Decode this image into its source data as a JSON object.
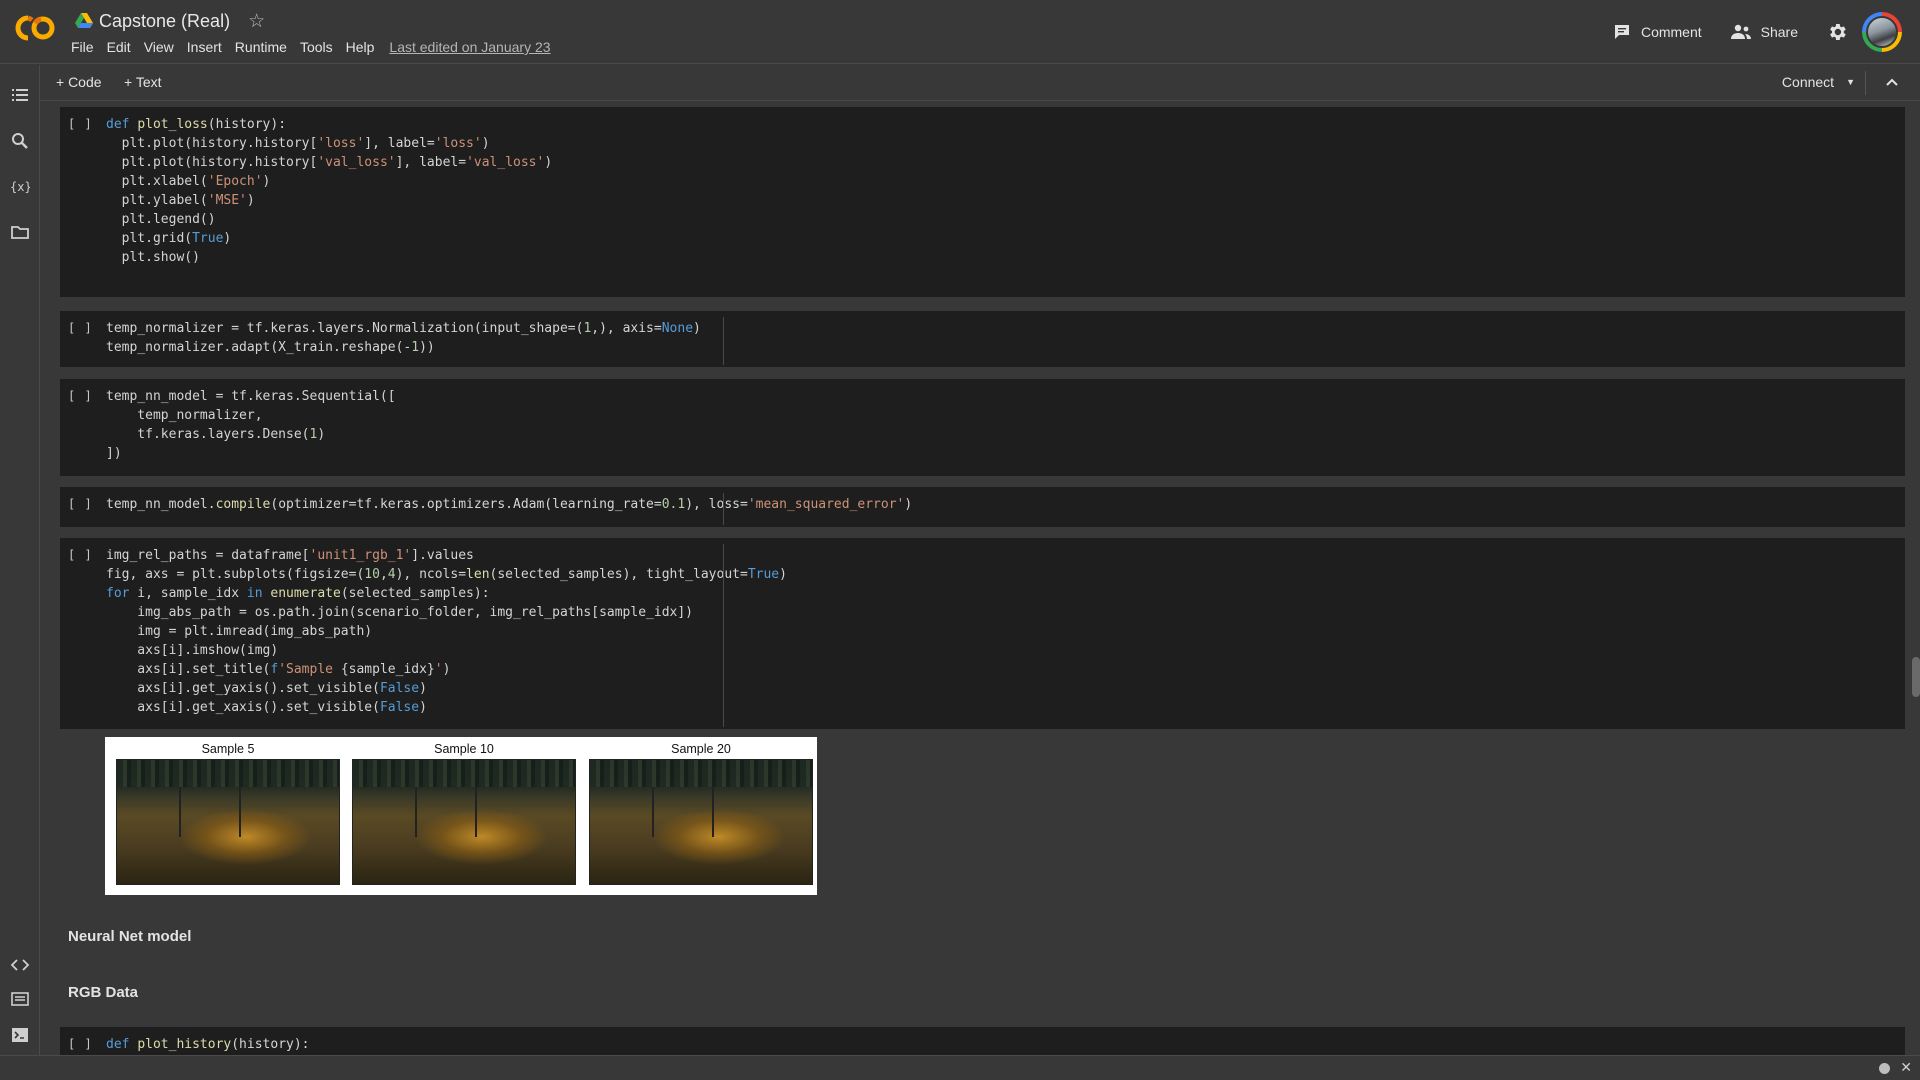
{
  "app": {
    "logo": "colab-logo",
    "title": "Capstone (Real)"
  },
  "menu": [
    "File",
    "Edit",
    "View",
    "Insert",
    "Runtime",
    "Tools",
    "Help"
  ],
  "last_edited": "Last edited on January 23",
  "header_actions": {
    "comment": "Comment",
    "share": "Share"
  },
  "toolbar": {
    "add_code": "+ Code",
    "add_text": "+ Text",
    "connect": "Connect"
  },
  "cells": [
    {
      "run": "[ ]"
    },
    {
      "run": "[ ]"
    },
    {
      "run": "[ ]"
    },
    {
      "run": "[ ]"
    },
    {
      "run": "[ ]"
    },
    {
      "run": "[ ]"
    }
  ],
  "figure": {
    "titles": [
      "Sample 5",
      "Sample 10",
      "Sample 20"
    ]
  },
  "headings": {
    "neural_net": "Neural Net model",
    "rgb_data": "RGB Data"
  },
  "icons": [
    "toc-icon",
    "search-icon",
    "variables-icon",
    "files-icon",
    "code-snippets-icon",
    "command-palette-icon",
    "terminal-icon",
    "gear-icon",
    "comment-icon",
    "share-icon",
    "star-icon",
    "drive-icon"
  ]
}
